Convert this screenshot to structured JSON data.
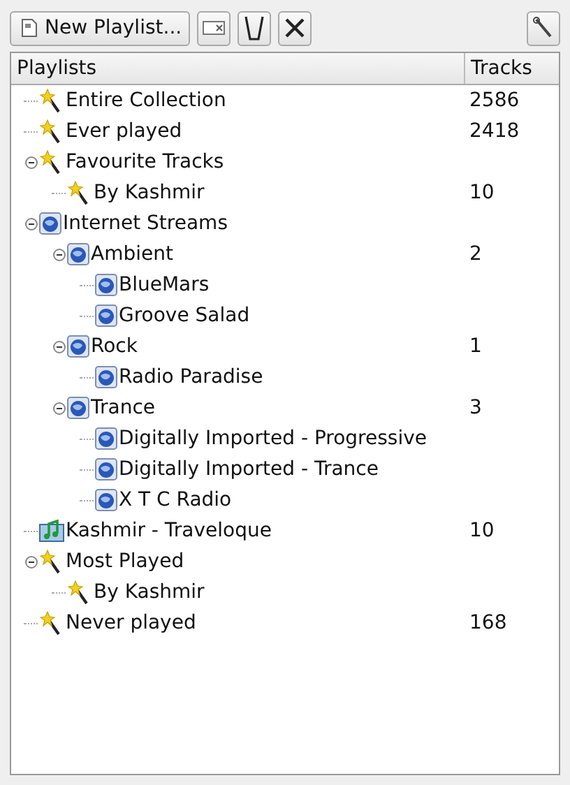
{
  "toolbar": {
    "new_playlist": "New Playlist..."
  },
  "table": {
    "columns": [
      "Playlists",
      "Tracks"
    ],
    "rows": [
      {
        "kind": "smart",
        "name": "Entire Collection",
        "tracks": "2586"
      },
      {
        "kind": "smart",
        "name": "Ever played",
        "tracks": "2418"
      },
      {
        "kind": "smart",
        "name": "Favourite Tracks",
        "expanded": true,
        "children": [
          {
            "kind": "smart",
            "name": "By Kashmir",
            "tracks": "10"
          }
        ]
      },
      {
        "kind": "stream",
        "name": "Internet Streams",
        "expanded": true,
        "children": [
          {
            "kind": "stream",
            "name": "Ambient",
            "tracks": "2",
            "expanded": true,
            "children": [
              {
                "kind": "stream",
                "name": "BlueMars"
              },
              {
                "kind": "stream",
                "name": "Groove Salad"
              }
            ]
          },
          {
            "kind": "stream",
            "name": "Rock",
            "tracks": "1",
            "expanded": true,
            "children": [
              {
                "kind": "stream",
                "name": "Radio Paradise"
              }
            ]
          },
          {
            "kind": "stream",
            "name": "Trance",
            "tracks": "3",
            "expanded": true,
            "children": [
              {
                "kind": "stream",
                "name": "Digitally Imported - Progressive"
              },
              {
                "kind": "stream",
                "name": "Digitally Imported - Trance"
              },
              {
                "kind": "stream",
                "name": "X T C Radio"
              }
            ]
          }
        ]
      },
      {
        "kind": "playlist",
        "name": "Kashmir - Traveloque",
        "tracks": "10"
      },
      {
        "kind": "smart",
        "name": "Most Played",
        "expanded": true,
        "children": [
          {
            "kind": "smart",
            "name": "By Kashmir"
          }
        ]
      },
      {
        "kind": "smart",
        "name": "Never played",
        "tracks": "168"
      }
    ]
  }
}
